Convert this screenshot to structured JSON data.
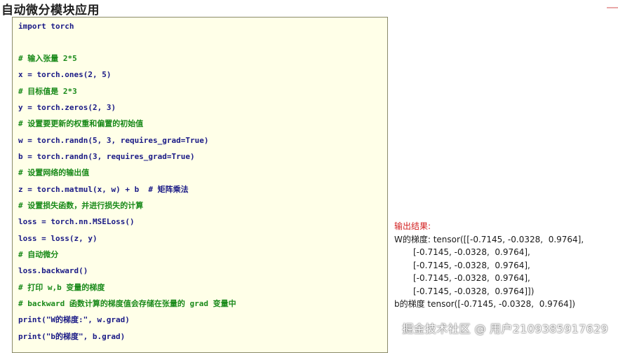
{
  "page": {
    "title": "自动微分模块应用"
  },
  "code": {
    "lines": [
      {
        "text": "import torch",
        "kind": "code"
      },
      {
        "text": "",
        "kind": "code"
      },
      {
        "text": "# 输入张量 2*5",
        "kind": "comment"
      },
      {
        "text": "x = torch.ones(2, 5)",
        "kind": "code"
      },
      {
        "text": "# 目标值是 2*3",
        "kind": "comment"
      },
      {
        "text": "y = torch.zeros(2, 3)",
        "kind": "code"
      },
      {
        "text": "# 设置要更新的权重和偏置的初始值",
        "kind": "comment"
      },
      {
        "text": "w = torch.randn(5, 3, requires_grad=True)",
        "kind": "code"
      },
      {
        "text": "b = torch.randn(3, requires_grad=True)",
        "kind": "code"
      },
      {
        "text": "# 设置网络的输出值",
        "kind": "comment"
      },
      {
        "text": "z = torch.matmul(x, w) + b  # 矩阵乘法",
        "kind": "code"
      },
      {
        "text": "# 设置损失函数，并进行损失的计算",
        "kind": "comment"
      },
      {
        "text": "loss = torch.nn.MSELoss()",
        "kind": "code"
      },
      {
        "text": "loss = loss(z, y)",
        "kind": "code"
      },
      {
        "text": "# 自动微分",
        "kind": "comment"
      },
      {
        "text": "loss.backward()",
        "kind": "code"
      },
      {
        "text": "# 打印 w,b 变量的梯度",
        "kind": "comment"
      },
      {
        "text": "# backward 函数计算的梯度值会存储在张量的 grad 变量中",
        "kind": "comment"
      },
      {
        "text": "print(\"W的梯度:\", w.grad)",
        "kind": "code"
      },
      {
        "text": "print(\"b的梯度\", b.grad)",
        "kind": "code"
      }
    ]
  },
  "output": {
    "title": "输出结果:",
    "w_first": "W的梯度: tensor([[-0.7145, -0.0328,  0.9764],",
    "w_rows": [
      "[-0.7145, -0.0328,  0.9764],",
      "[-0.7145, -0.0328,  0.9764],",
      "[-0.7145, -0.0328,  0.9764],",
      "[-0.7145, -0.0328,  0.9764]])"
    ],
    "b_line": "b的梯度 tensor([-0.7145, -0.0328,  0.9764])"
  },
  "watermark": {
    "text": "掘金技术社区 @ 用户2109385917629"
  },
  "colors": {
    "code_background": "#ffffe8",
    "code_text": "#1a1a86",
    "comment_text": "#1a8a1a",
    "output_title": "#d21e1e"
  }
}
